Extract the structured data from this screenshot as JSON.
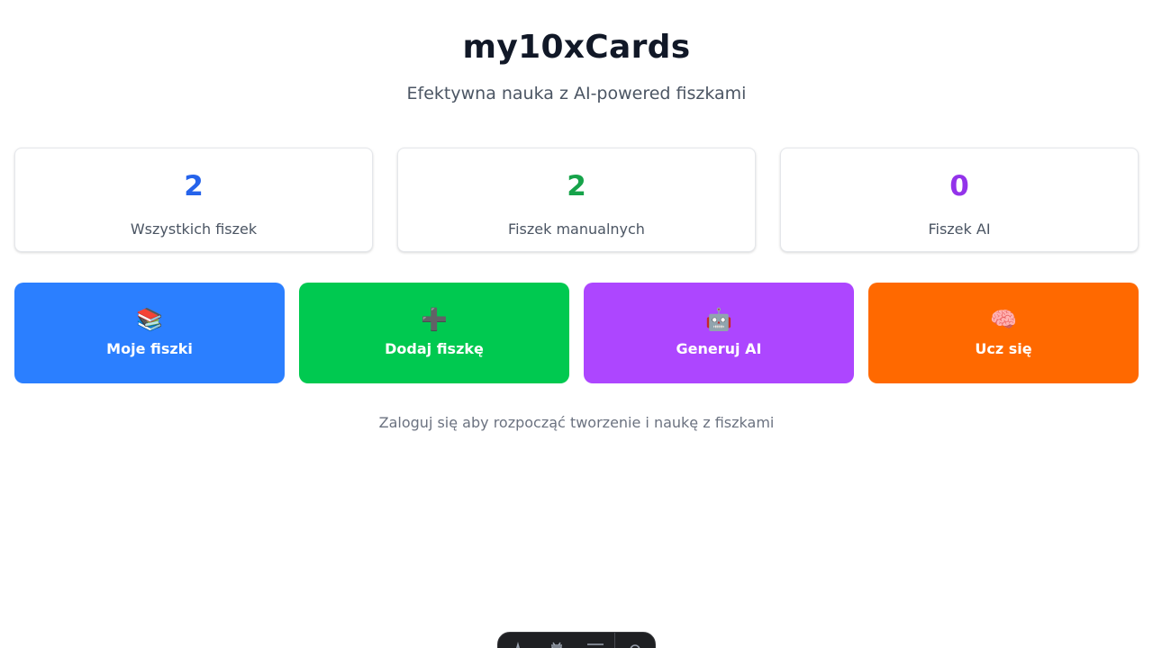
{
  "header": {
    "title": "my10xCards",
    "subtitle": "Efektywna nauka z AI-powered fiszkami"
  },
  "stats": [
    {
      "value": "2",
      "label": "Wszystkich fiszek",
      "color": "#2563eb"
    },
    {
      "value": "2",
      "label": "Fiszek manualnych",
      "color": "#16a34a"
    },
    {
      "value": "0",
      "label": "Fiszek AI",
      "color": "#9333ea"
    }
  ],
  "actions": [
    {
      "icon": "📚",
      "icon_name": "books-icon",
      "label": "Moje fiszki",
      "color": "#2b7fff"
    },
    {
      "icon": "➕",
      "icon_name": "plus-icon",
      "label": "Dodaj fiszkę",
      "color": "#00c950"
    },
    {
      "icon": "🤖",
      "icon_name": "robot-icon",
      "label": "Generuj AI",
      "color": "#ad46ff"
    },
    {
      "icon": "🧠",
      "icon_name": "brain-icon",
      "label": "Ucz się",
      "color": "#ff6900"
    }
  ],
  "login_hint": "Zaloguj się aby rozpocząć tworzenie i naukę z fiszkami",
  "dev_toolbar": {
    "icons": [
      "astro-icon",
      "audit-icon",
      "menu-icon",
      "settings-icon"
    ],
    "background": "#1f2023"
  }
}
